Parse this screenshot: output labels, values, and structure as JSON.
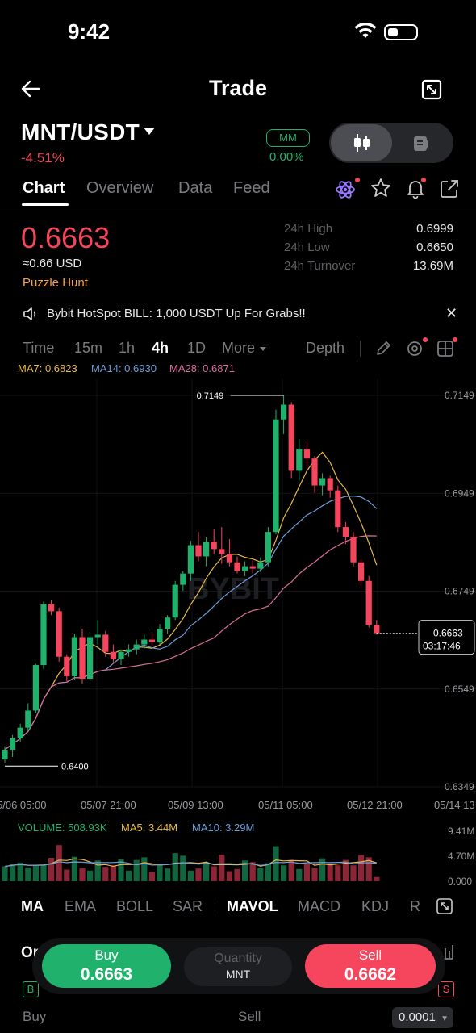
{
  "status": {
    "time": "9:42"
  },
  "header": {
    "title": "Trade"
  },
  "pair": {
    "symbol": "MNT/USDT",
    "change": "-4.51%",
    "mm_label": "MM",
    "mm_value": "0.00%"
  },
  "tabs": [
    "Chart",
    "Overview",
    "Data",
    "Feed"
  ],
  "price": {
    "last": "0.6663",
    "usd": "≈0.66 USD",
    "promo": "Puzzle Hunt",
    "stats": [
      {
        "label": "24h High",
        "value": "0.6999"
      },
      {
        "label": "24h Low",
        "value": "0.6650"
      },
      {
        "label": "24h Turnover",
        "value": "13.69M"
      }
    ]
  },
  "announcement": {
    "text": "Bybit HotSpot BILL: 1,000 USDT Up For Grabs!!"
  },
  "timeframes": [
    "Time",
    "15m",
    "1h",
    "4h",
    "1D",
    "More",
    "Depth"
  ],
  "active_timeframe": "4h",
  "ma_legend": {
    "ma7": "MA7: 0.6823",
    "ma14": "MA14: 0.6930",
    "ma28": "MA28: 0.6871"
  },
  "colors": {
    "up": "#20b26c",
    "down": "#f6465d",
    "ma7": "#e9b949",
    "ma14": "#6f9fd8",
    "ma28": "#d86e9c"
  },
  "chart_data": {
    "type": "candlestick",
    "watermark": "BYBIT",
    "y_axis_labels": [
      "0.7149",
      "0.6949",
      "0.6749",
      "0.6549",
      "0.6349"
    ],
    "ylim": [
      0.6349,
      0.7149
    ],
    "x_axis_labels": [
      "5/06 05:00",
      "05/07 21:00",
      "05/09 13:00",
      "05/11 05:00",
      "05/12 21:00",
      "05/14 13"
    ],
    "max_label": "0.7149",
    "min_label": "0.6400",
    "current_price": "0.6663",
    "countdown": "03:17:46",
    "candles": [
      {
        "o": 0.6405,
        "h": 0.6432,
        "l": 0.6398,
        "c": 0.6425
      },
      {
        "o": 0.6425,
        "h": 0.6455,
        "l": 0.641,
        "c": 0.6448
      },
      {
        "o": 0.6448,
        "h": 0.6478,
        "l": 0.644,
        "c": 0.647
      },
      {
        "o": 0.647,
        "h": 0.652,
        "l": 0.6462,
        "c": 0.6505
      },
      {
        "o": 0.6505,
        "h": 0.66,
        "l": 0.65,
        "c": 0.6598
      },
      {
        "o": 0.6598,
        "h": 0.6728,
        "l": 0.659,
        "c": 0.6722
      },
      {
        "o": 0.6722,
        "h": 0.673,
        "l": 0.67,
        "c": 0.6708
      },
      {
        "o": 0.6708,
        "h": 0.6715,
        "l": 0.6605,
        "c": 0.6615
      },
      {
        "o": 0.6615,
        "h": 0.662,
        "l": 0.6565,
        "c": 0.6575
      },
      {
        "o": 0.6575,
        "h": 0.6662,
        "l": 0.6568,
        "c": 0.6655
      },
      {
        "o": 0.6655,
        "h": 0.6672,
        "l": 0.656,
        "c": 0.657
      },
      {
        "o": 0.657,
        "h": 0.6665,
        "l": 0.6565,
        "c": 0.6655
      },
      {
        "o": 0.6655,
        "h": 0.669,
        "l": 0.664,
        "c": 0.666
      },
      {
        "o": 0.666,
        "h": 0.6668,
        "l": 0.6615,
        "c": 0.6625
      },
      {
        "o": 0.6625,
        "h": 0.664,
        "l": 0.66,
        "c": 0.661
      },
      {
        "o": 0.661,
        "h": 0.663,
        "l": 0.6598,
        "c": 0.6625
      },
      {
        "o": 0.6625,
        "h": 0.664,
        "l": 0.6615,
        "c": 0.663
      },
      {
        "o": 0.663,
        "h": 0.665,
        "l": 0.662,
        "c": 0.664
      },
      {
        "o": 0.664,
        "h": 0.666,
        "l": 0.6632,
        "c": 0.665
      },
      {
        "o": 0.665,
        "h": 0.6665,
        "l": 0.6638,
        "c": 0.6645
      },
      {
        "o": 0.6645,
        "h": 0.6682,
        "l": 0.664,
        "c": 0.6672
      },
      {
        "o": 0.6672,
        "h": 0.67,
        "l": 0.6662,
        "c": 0.6695
      },
      {
        "o": 0.6695,
        "h": 0.677,
        "l": 0.669,
        "c": 0.6762
      },
      {
        "o": 0.6762,
        "h": 0.679,
        "l": 0.675,
        "c": 0.6785
      },
      {
        "o": 0.6785,
        "h": 0.6852,
        "l": 0.677,
        "c": 0.6843
      },
      {
        "o": 0.6843,
        "h": 0.687,
        "l": 0.681,
        "c": 0.682
      },
      {
        "o": 0.682,
        "h": 0.686,
        "l": 0.68,
        "c": 0.685
      },
      {
        "o": 0.685,
        "h": 0.6875,
        "l": 0.6825,
        "c": 0.6835
      },
      {
        "o": 0.6835,
        "h": 0.688,
        "l": 0.6805,
        "c": 0.6825
      },
      {
        "o": 0.6825,
        "h": 0.6855,
        "l": 0.68,
        "c": 0.6808
      },
      {
        "o": 0.6808,
        "h": 0.682,
        "l": 0.6785,
        "c": 0.679
      },
      {
        "o": 0.679,
        "h": 0.681,
        "l": 0.678,
        "c": 0.68
      },
      {
        "o": 0.68,
        "h": 0.6812,
        "l": 0.6785,
        "c": 0.6795
      },
      {
        "o": 0.6795,
        "h": 0.6818,
        "l": 0.6788,
        "c": 0.6808
      },
      {
        "o": 0.6808,
        "h": 0.688,
        "l": 0.68,
        "c": 0.687
      },
      {
        "o": 0.687,
        "h": 0.712,
        "l": 0.6865,
        "c": 0.71
      },
      {
        "o": 0.71,
        "h": 0.7149,
        "l": 0.707,
        "c": 0.713
      },
      {
        "o": 0.713,
        "h": 0.7135,
        "l": 0.698,
        "c": 0.6995
      },
      {
        "o": 0.6995,
        "h": 0.706,
        "l": 0.6975,
        "c": 0.704
      },
      {
        "o": 0.704,
        "h": 0.7055,
        "l": 0.7,
        "c": 0.702
      },
      {
        "o": 0.702,
        "h": 0.7025,
        "l": 0.695,
        "c": 0.6965
      },
      {
        "o": 0.6965,
        "h": 0.699,
        "l": 0.6945,
        "c": 0.698
      },
      {
        "o": 0.698,
        "h": 0.6985,
        "l": 0.694,
        "c": 0.6955
      },
      {
        "o": 0.6955,
        "h": 0.6965,
        "l": 0.687,
        "c": 0.688
      },
      {
        "o": 0.688,
        "h": 0.689,
        "l": 0.6845,
        "c": 0.686
      },
      {
        "o": 0.686,
        "h": 0.687,
        "l": 0.68,
        "c": 0.6808
      },
      {
        "o": 0.6808,
        "h": 0.6815,
        "l": 0.676,
        "c": 0.677
      },
      {
        "o": 0.677,
        "h": 0.678,
        "l": 0.6675,
        "c": 0.668
      },
      {
        "o": 0.668,
        "h": 0.669,
        "l": 0.666,
        "c": 0.6663
      }
    ],
    "volume_legend": {
      "volume": "VOLUME: 508.93K",
      "ma5": "MA5: 3.44M",
      "ma10": "MA10: 3.29M"
    },
    "volume_axis_labels": [
      "9.41M",
      "4.70M",
      "0.000"
    ],
    "volume_max": 9.41,
    "volume": [
      2.8,
      3.2,
      3.5,
      2.6,
      3.0,
      3.1,
      4.4,
      6.8,
      2.2,
      4.6,
      2.5,
      2.0,
      3.9,
      2.7,
      3.0,
      4.1,
      2.0,
      4.0,
      4.5,
      1.8,
      3.0,
      2.4,
      5.3,
      4.8,
      2.0,
      2.4,
      3.5,
      2.8,
      5.0,
      1.9,
      2.3,
      3.9,
      3.6,
      2.5,
      3.4,
      6.6,
      3.0,
      4.0,
      2.3,
      3.2,
      2.5,
      4.3,
      3.2,
      3.0,
      4.0,
      3.0,
      5.0,
      4.5,
      0.8
    ]
  },
  "indicators": [
    "MA",
    "EMA",
    "BOLL",
    "SAR",
    "MAVOL",
    "MACD",
    "KDJ",
    "R"
  ],
  "active_indicators": [
    "MA",
    "MAVOL"
  ],
  "trade": {
    "buy_label": "Buy",
    "buy_price": "0.6663",
    "qty_label": "Quantity",
    "qty_unit": "MNT",
    "sell_label": "Sell",
    "sell_price": "0.6662"
  },
  "orderbook": {
    "buy_label": "Buy",
    "sell_label": "Sell",
    "precision": "0.0001"
  }
}
